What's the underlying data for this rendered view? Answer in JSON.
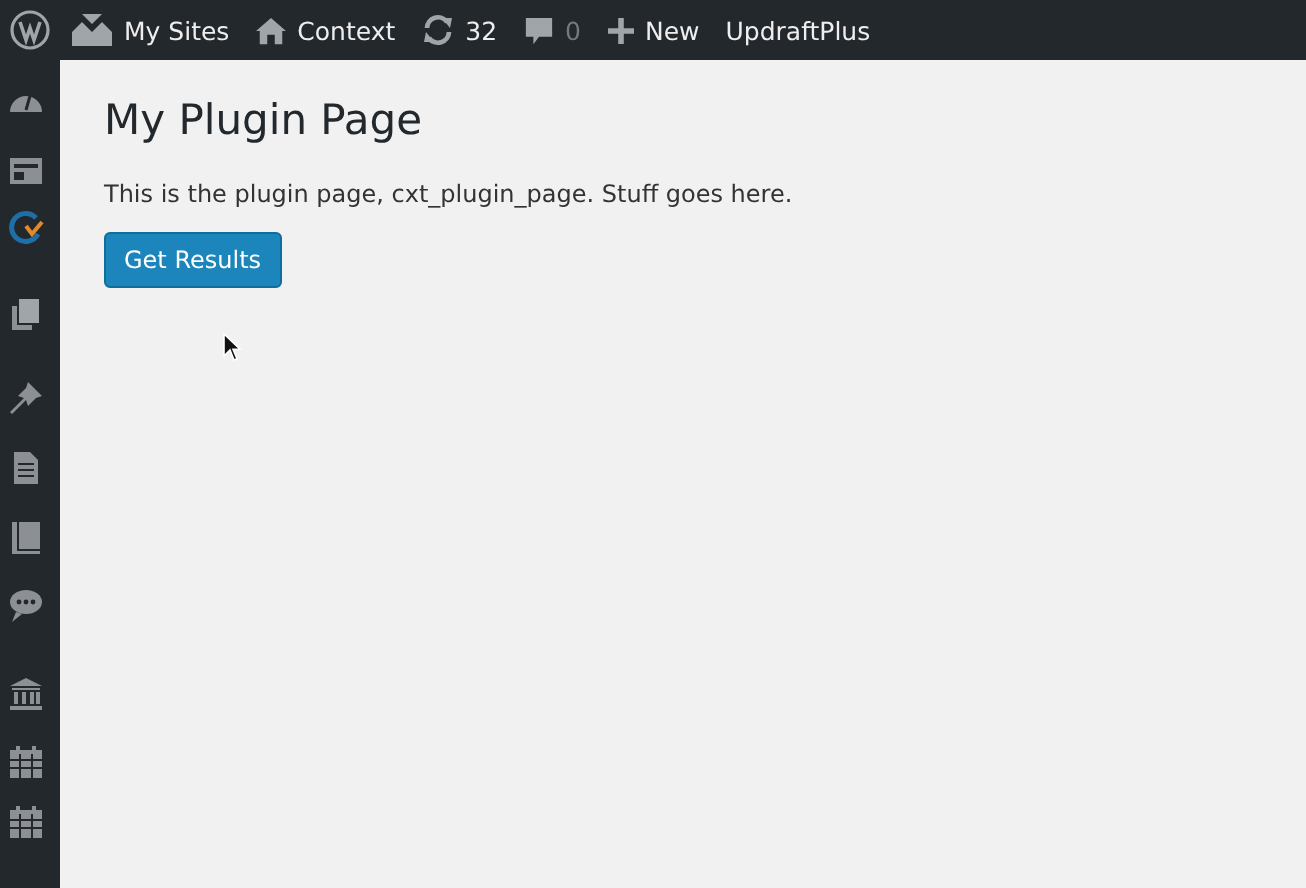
{
  "admin_bar": {
    "items": [
      {
        "label": "My Sites"
      },
      {
        "label": "Context"
      },
      {
        "label": "32"
      },
      {
        "label": "0"
      },
      {
        "label": "New"
      },
      {
        "label": "UpdraftPlus"
      }
    ]
  },
  "page": {
    "title": "My Plugin Page",
    "description": "This is the plugin page, cxt_plugin_page. Stuff goes here.",
    "button": "Get Results"
  }
}
